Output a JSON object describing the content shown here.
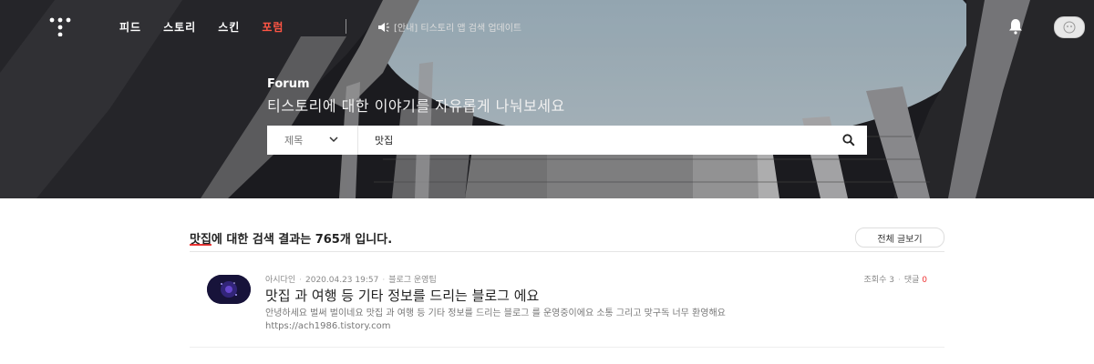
{
  "nav": {
    "items": [
      {
        "label": "피드",
        "active": false
      },
      {
        "label": "스토리",
        "active": false
      },
      {
        "label": "스킨",
        "active": false
      },
      {
        "label": "포럼",
        "active": true
      }
    ],
    "notice": "[안내] 티스토리 앱 검색 업데이트"
  },
  "hero": {
    "label": "Forum",
    "description": "티스토리에 대한 이야기를 자유롭게 나눠보세요"
  },
  "search": {
    "category": "제목",
    "query": "맛집"
  },
  "results": {
    "keyword": "맛집",
    "summary_suffix": "에 대한 검색 결과는 765개 입니다.",
    "view_all_label": "전체 글보기"
  },
  "post": {
    "author": "아시다인",
    "date": "2020.04.23 19:57",
    "category": "블로그 운영팁",
    "views_label": "조회수 3",
    "comments_label": "댓글",
    "comments_count": "0",
    "title": "맛집 과 여행 등 기타 정보를 드리는 블로그 에요",
    "excerpt": "안녕하세요 벌써 벌이네요 맛집 과 여행 등 기타 정보를 드리는 블로그 를 운영중이에요 소통 그리고 맞구독 너무 환영해요 https://ach1986.tistory.com"
  },
  "colors": {
    "accent": "#ff5544",
    "comment_count": "#e33333"
  }
}
